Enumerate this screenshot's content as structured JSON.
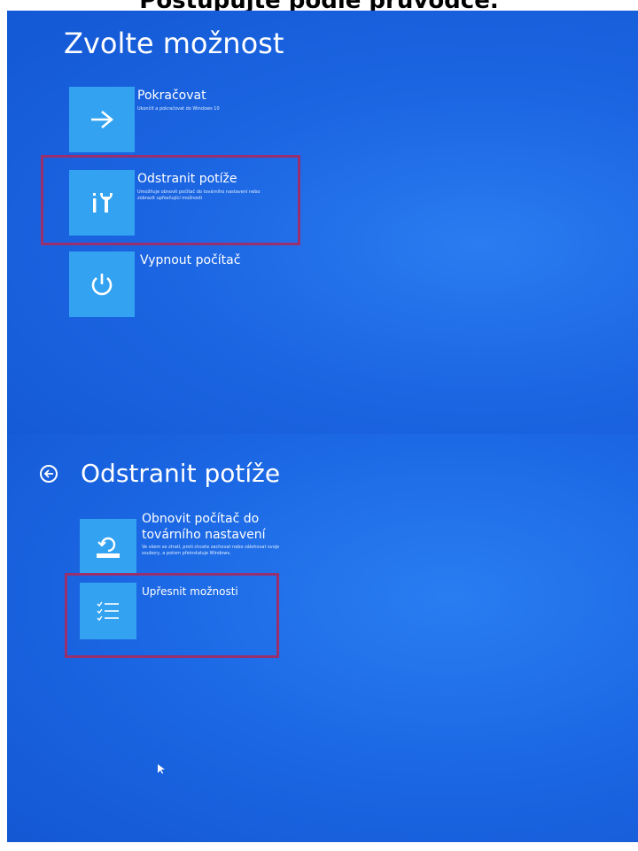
{
  "caption": "Postupujte podle průvodce.",
  "top_screen": {
    "title": "Zvolte možnost",
    "options": [
      {
        "label": "Pokračovat",
        "description": "Ukončit a pokračovat do Windows 10",
        "icon": "arrow-right-icon"
      },
      {
        "label": "Odstranit potíže",
        "description": "Umožňuje obnovit počítač do továrního nastavení nebo zobrazit upřesňující možnosti",
        "icon": "tools-icon",
        "highlighted": true
      },
      {
        "label": "Vypnout počítač",
        "description": "",
        "icon": "power-icon"
      }
    ]
  },
  "bottom_screen": {
    "title": "Odstranit potíže",
    "back_icon": "back-arrow-icon",
    "options": [
      {
        "label_line1": "Obnovit počítač do",
        "label_line2": "továrního nastavení",
        "description": "Ve všem se ztratí, proti chcete zachovat nebo zálohovat svoje soubory, a potom přeinstaluje Windows.",
        "icon": "reset-icon"
      },
      {
        "label": "Upřesnit možnosti",
        "description": "",
        "icon": "checklist-icon",
        "highlighted": true
      }
    ]
  },
  "colors": {
    "background": "#1c66e3",
    "tile": "#33a2f1",
    "highlight_border": "#9a2f6e",
    "text": "#ffffff"
  }
}
